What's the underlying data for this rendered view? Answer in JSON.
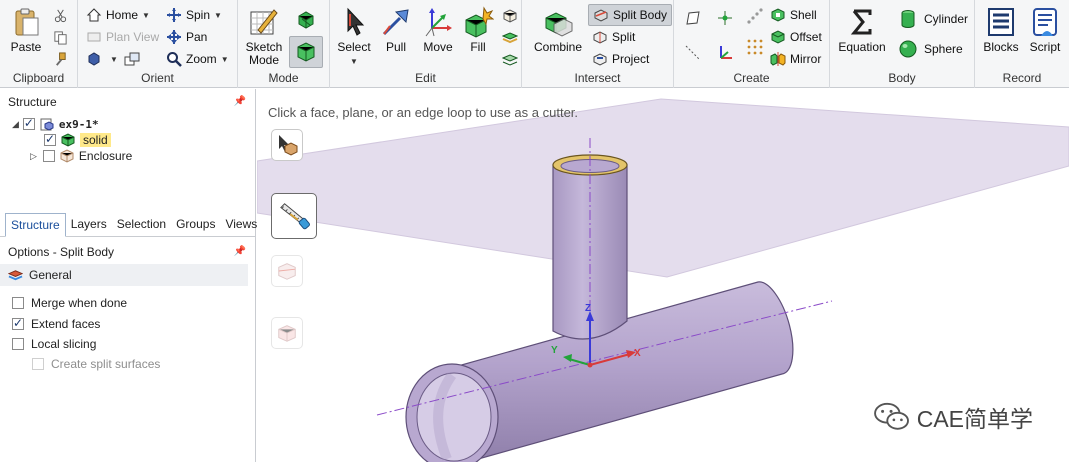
{
  "ribbon": {
    "clipboard": {
      "label": "Clipboard",
      "paste": "Paste"
    },
    "orient": {
      "label": "Orient",
      "home": "Home",
      "plan_view": "Plan View",
      "spin": "Spin",
      "pan": "Pan",
      "zoom": "Zoom"
    },
    "mode": {
      "label": "Mode",
      "sketch_mode": "Sketch Mode"
    },
    "edit": {
      "label": "Edit",
      "select": "Select",
      "pull": "Pull",
      "move": "Move",
      "fill": "Fill"
    },
    "intersect": {
      "label": "Intersect",
      "combine": "Combine",
      "split_body": "Split Body",
      "split": "Split",
      "project": "Project"
    },
    "create": {
      "label": "Create",
      "shell": "Shell",
      "offset": "Offset",
      "mirror": "Mirror"
    },
    "body": {
      "label": "Body",
      "equation": "Equation",
      "cylinder": "Cylinder",
      "sphere": "Sphere"
    },
    "record": {
      "label": "Record",
      "blocks": "Blocks",
      "script": "Script"
    }
  },
  "structure": {
    "title": "Structure",
    "tree": {
      "root": "ex9-1*",
      "solid": "solid",
      "enclosure": "Enclosure"
    }
  },
  "tabs": [
    "Structure",
    "Layers",
    "Selection",
    "Groups",
    "Views"
  ],
  "options": {
    "title": "Options - Split Body",
    "section": "General",
    "merge_when_done": "Merge when done",
    "extend_faces": "Extend faces",
    "local_slicing": "Local slicing",
    "create_split_surfaces": "Create split surfaces",
    "checked": {
      "merge_when_done": false,
      "extend_faces": true,
      "local_slicing": false,
      "create_split_surfaces": false
    }
  },
  "viewport": {
    "hint": "Click a face, plane, or an edge loop to use as a cutter.",
    "triad": {
      "x": "X",
      "y": "Y",
      "z": "Z"
    },
    "watermark": "CAE简单学"
  },
  "colors": {
    "body": "#b3a3cc",
    "plane": "#e3dcea",
    "accent": "#1b4f9c",
    "axis_x": "#d83a3a",
    "axis_y": "#22a33a",
    "axis_z": "#3a3ad8"
  }
}
